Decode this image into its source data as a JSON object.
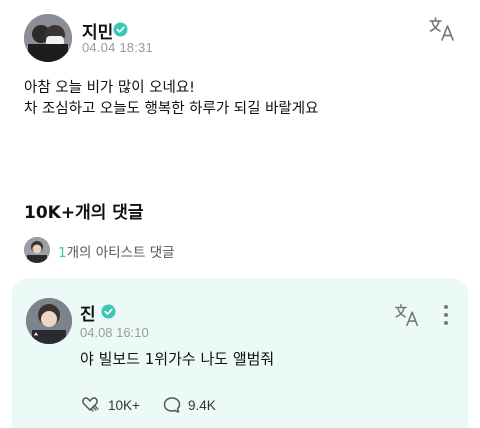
{
  "post": {
    "author": "지민",
    "time": "04.04 18:31",
    "body_lines": [
      "아참 오늘 비가 많이 오네요!",
      "차 조심하고 오늘도 행복한 하루가 되길 바랄게요"
    ]
  },
  "comments": {
    "title": "10K+개의 댓글",
    "artist_count": "1",
    "artist_suffix": "개의 아티스트 댓글"
  },
  "comment": {
    "author": "진",
    "time": "04.08 16:10",
    "text": "야 빌보드 1위가수 나도 앨범줘",
    "likes": "10K+",
    "replies": "9.4K"
  },
  "colors": {
    "accent": "#3cc6b6",
    "verified": "#3cc6b6",
    "card_bg": "#ebfaf7"
  },
  "icons": [
    "verified-icon",
    "translate-icon",
    "more-vertical-icon",
    "like-icon",
    "comment-icon"
  ]
}
